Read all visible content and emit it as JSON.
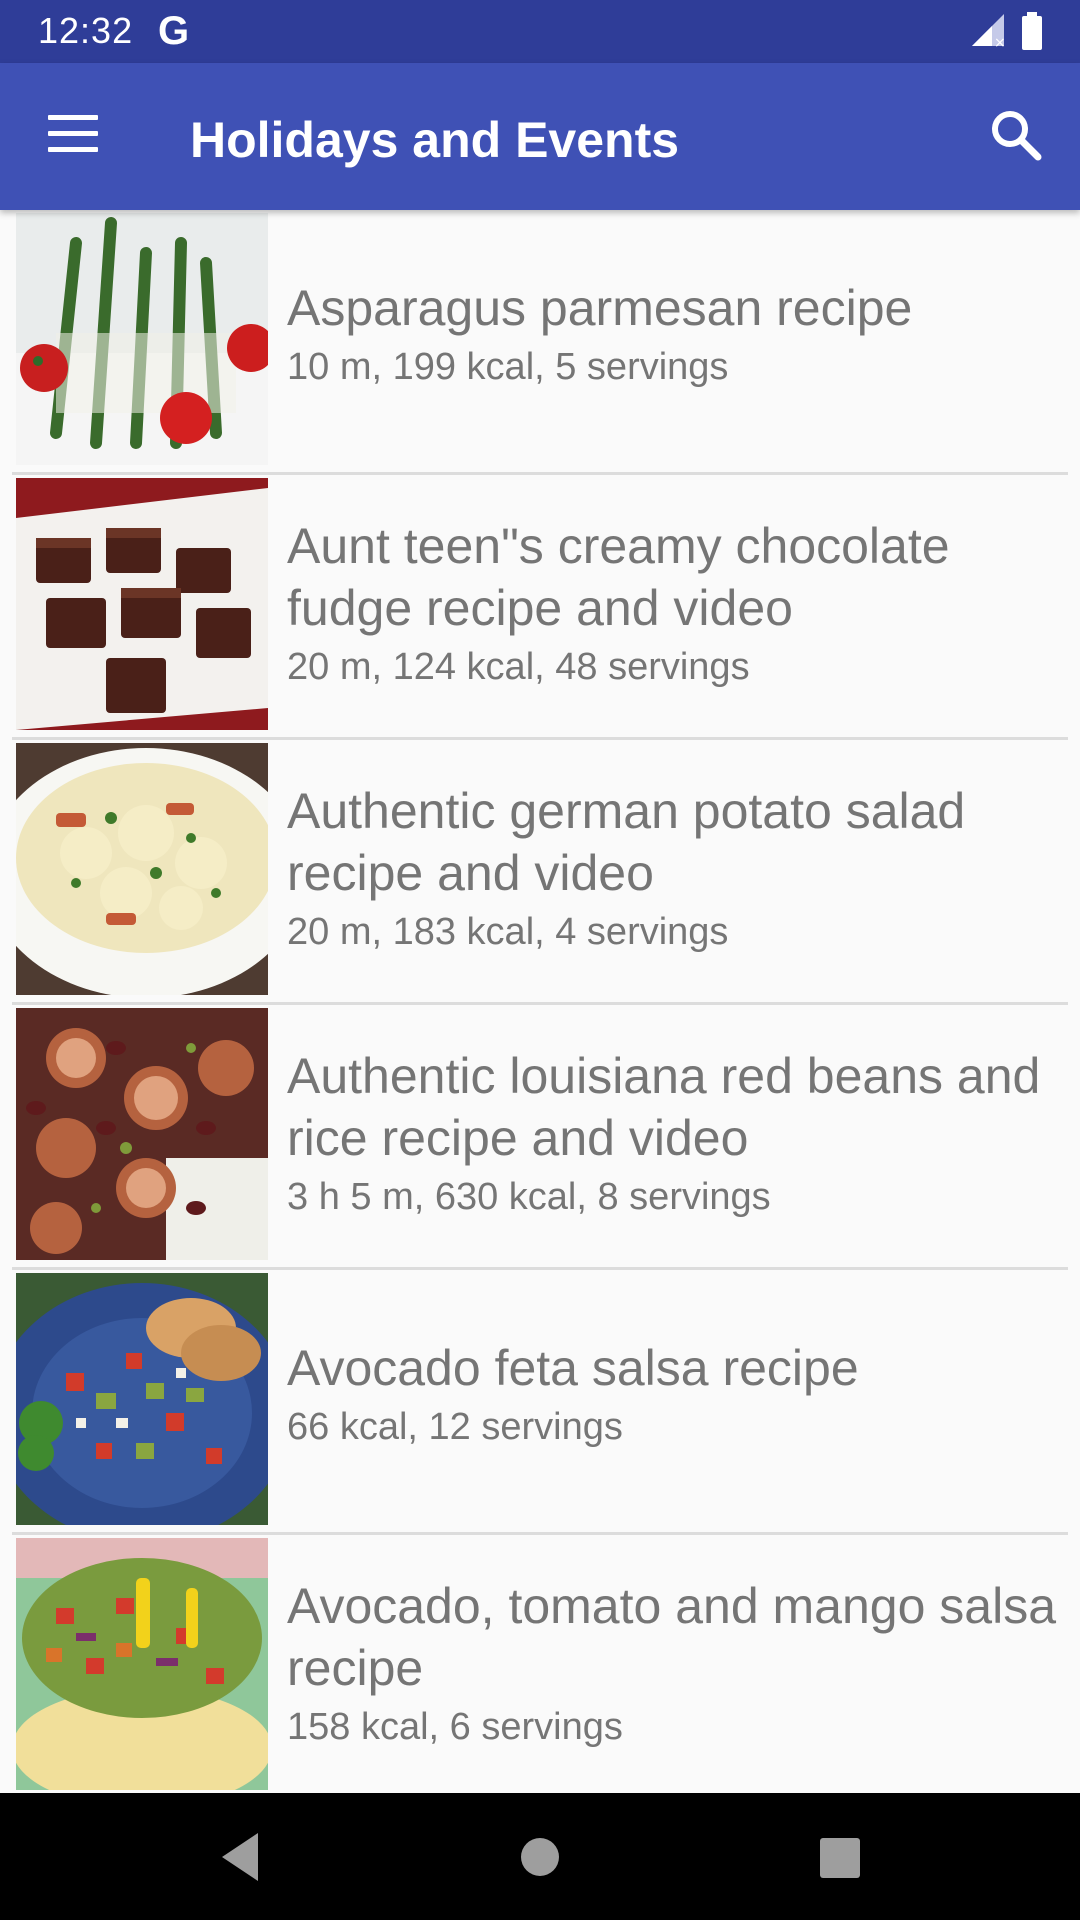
{
  "status_bar": {
    "time": "12:32",
    "g_label": "G",
    "icons": [
      "signal-icon",
      "battery-icon"
    ]
  },
  "app_bar": {
    "title": "Holidays and Events",
    "menu_icon": "hamburger-menu-icon",
    "search_icon": "search-icon",
    "color": "#3f51b5"
  },
  "recipes": [
    {
      "title": "Asparagus parmesan recipe",
      "meta": "10 m, 199 kcal, 5 servings"
    },
    {
      "title": "Aunt teen\"s creamy chocolate fudge recipe and video",
      "meta": "20 m, 124 kcal, 48 servings"
    },
    {
      "title": "Authentic german potato salad recipe and video",
      "meta": "20 m, 183 kcal, 4 servings"
    },
    {
      "title": "Authentic louisiana red beans and rice recipe and video",
      "meta": "3 h 5 m, 630 kcal, 8 servings"
    },
    {
      "title": "Avocado feta salsa recipe",
      "meta": "66 kcal, 12 servings"
    },
    {
      "title": "Avocado, tomato and mango salsa recipe",
      "meta": "158 kcal, 6 servings"
    }
  ],
  "nav_bar": {
    "icons": [
      "back-icon",
      "home-icon",
      "recent-apps-icon"
    ]
  }
}
